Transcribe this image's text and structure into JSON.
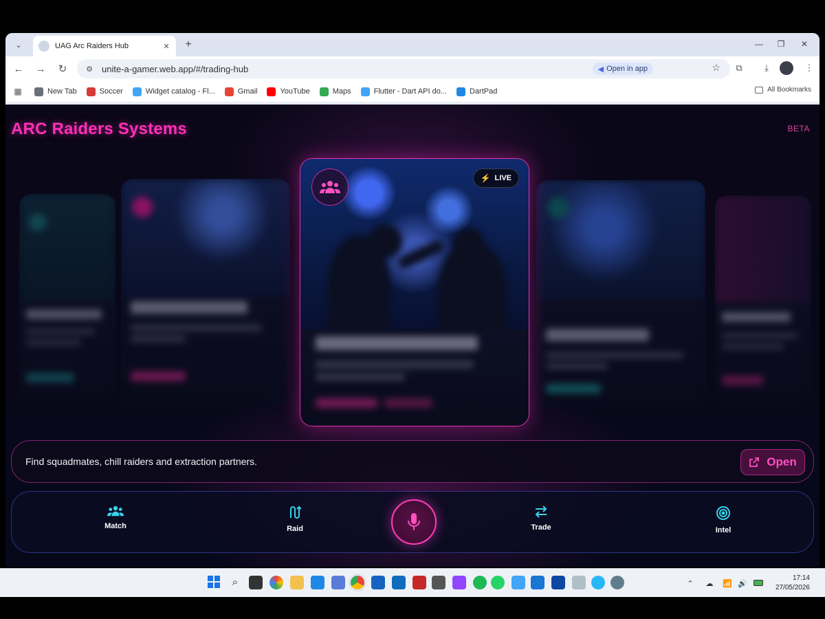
{
  "browser": {
    "tab_title": "UAG Arc Raiders Hub",
    "url": "unite-a-gamer.web.app/#/trading-hub",
    "open_in_app": "Open in app",
    "bookmarks": [
      {
        "label": "New Tab",
        "color": "#6b6f7a"
      },
      {
        "label": "Soccer",
        "color": "#d83a3a"
      },
      {
        "label": "Widget catalog - Fl...",
        "color": "#42a5f5"
      },
      {
        "label": "Gmail",
        "color": "#ea4335"
      },
      {
        "label": "YouTube",
        "color": "#ff0000"
      },
      {
        "label": "Maps",
        "color": "#34a853"
      },
      {
        "label": "Flutter - Dart API do...",
        "color": "#42a5f5"
      },
      {
        "label": "DartPad",
        "color": "#1e88e5"
      }
    ],
    "all_bookmarks": "All Bookmarks"
  },
  "app": {
    "title": "ARC Raiders Systems",
    "badge": "BETA",
    "accent": "#ff2fb8",
    "featured_card": {
      "status": "LIVE",
      "icon": "group-icon"
    },
    "info_text": "Find squadmates, chill raiders and extraction partners.",
    "open_label": "Open"
  },
  "bottom_nav": {
    "items": [
      {
        "label": "Match",
        "icon": "group-icon"
      },
      {
        "label": "Raid",
        "icon": "route-icon"
      },
      {
        "label": "Trade",
        "icon": "swap-icon"
      },
      {
        "label": "Intel",
        "icon": "radar-icon"
      }
    ],
    "center": {
      "icon": "microphone-icon"
    }
  },
  "taskbar": {
    "time": "17:14",
    "date": "27/05/2026"
  }
}
